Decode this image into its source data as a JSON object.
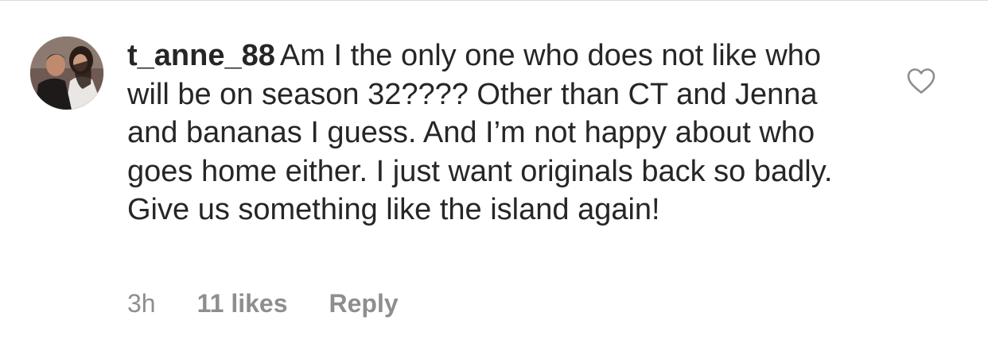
{
  "comment": {
    "username": "t_anne_88",
    "text": "Am I the only one who does not like who will be on season 32???? Other than CT and Jenna and bananas I guess. And I’m not happy about who goes home either. I just want originals back so badly. Give us something like the island again!",
    "timestamp": "3h",
    "likes": "11 likes",
    "reply_label": "Reply",
    "like_icon": "heart-outline-icon"
  },
  "colors": {
    "text": "#262626",
    "meta": "#8e8e8e",
    "divider": "#dbdbdb",
    "heart_stroke": "#8e8e8e"
  }
}
